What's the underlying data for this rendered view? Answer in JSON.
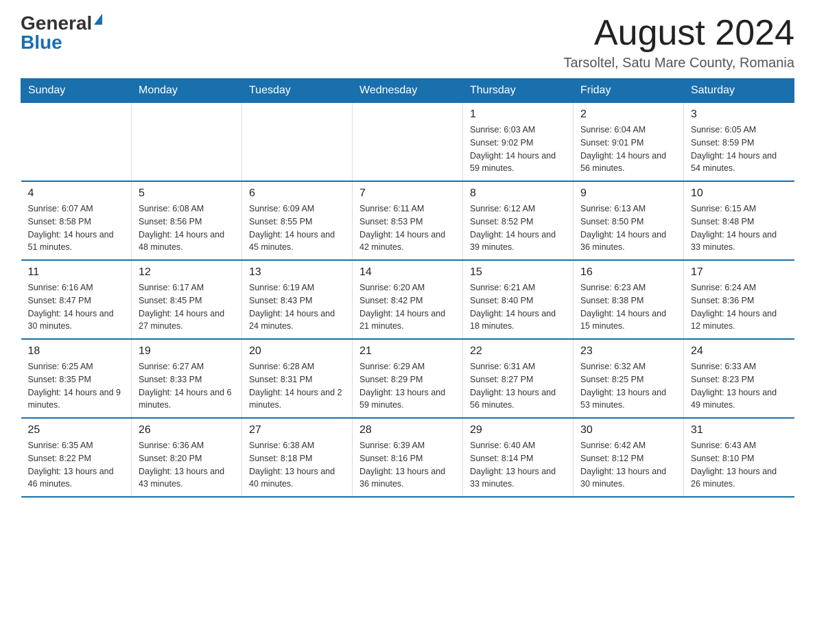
{
  "logo": {
    "general": "General",
    "blue": "Blue",
    "triangle": "▶"
  },
  "header": {
    "month_year": "August 2024",
    "location": "Tarsoltel, Satu Mare County, Romania"
  },
  "weekdays": [
    "Sunday",
    "Monday",
    "Tuesday",
    "Wednesday",
    "Thursday",
    "Friday",
    "Saturday"
  ],
  "weeks": [
    [
      {
        "day": "",
        "info": ""
      },
      {
        "day": "",
        "info": ""
      },
      {
        "day": "",
        "info": ""
      },
      {
        "day": "",
        "info": ""
      },
      {
        "day": "1",
        "info": "Sunrise: 6:03 AM\nSunset: 9:02 PM\nDaylight: 14 hours and 59 minutes."
      },
      {
        "day": "2",
        "info": "Sunrise: 6:04 AM\nSunset: 9:01 PM\nDaylight: 14 hours and 56 minutes."
      },
      {
        "day": "3",
        "info": "Sunrise: 6:05 AM\nSunset: 8:59 PM\nDaylight: 14 hours and 54 minutes."
      }
    ],
    [
      {
        "day": "4",
        "info": "Sunrise: 6:07 AM\nSunset: 8:58 PM\nDaylight: 14 hours and 51 minutes."
      },
      {
        "day": "5",
        "info": "Sunrise: 6:08 AM\nSunset: 8:56 PM\nDaylight: 14 hours and 48 minutes."
      },
      {
        "day": "6",
        "info": "Sunrise: 6:09 AM\nSunset: 8:55 PM\nDaylight: 14 hours and 45 minutes."
      },
      {
        "day": "7",
        "info": "Sunrise: 6:11 AM\nSunset: 8:53 PM\nDaylight: 14 hours and 42 minutes."
      },
      {
        "day": "8",
        "info": "Sunrise: 6:12 AM\nSunset: 8:52 PM\nDaylight: 14 hours and 39 minutes."
      },
      {
        "day": "9",
        "info": "Sunrise: 6:13 AM\nSunset: 8:50 PM\nDaylight: 14 hours and 36 minutes."
      },
      {
        "day": "10",
        "info": "Sunrise: 6:15 AM\nSunset: 8:48 PM\nDaylight: 14 hours and 33 minutes."
      }
    ],
    [
      {
        "day": "11",
        "info": "Sunrise: 6:16 AM\nSunset: 8:47 PM\nDaylight: 14 hours and 30 minutes."
      },
      {
        "day": "12",
        "info": "Sunrise: 6:17 AM\nSunset: 8:45 PM\nDaylight: 14 hours and 27 minutes."
      },
      {
        "day": "13",
        "info": "Sunrise: 6:19 AM\nSunset: 8:43 PM\nDaylight: 14 hours and 24 minutes."
      },
      {
        "day": "14",
        "info": "Sunrise: 6:20 AM\nSunset: 8:42 PM\nDaylight: 14 hours and 21 minutes."
      },
      {
        "day": "15",
        "info": "Sunrise: 6:21 AM\nSunset: 8:40 PM\nDaylight: 14 hours and 18 minutes."
      },
      {
        "day": "16",
        "info": "Sunrise: 6:23 AM\nSunset: 8:38 PM\nDaylight: 14 hours and 15 minutes."
      },
      {
        "day": "17",
        "info": "Sunrise: 6:24 AM\nSunset: 8:36 PM\nDaylight: 14 hours and 12 minutes."
      }
    ],
    [
      {
        "day": "18",
        "info": "Sunrise: 6:25 AM\nSunset: 8:35 PM\nDaylight: 14 hours and 9 minutes."
      },
      {
        "day": "19",
        "info": "Sunrise: 6:27 AM\nSunset: 8:33 PM\nDaylight: 14 hours and 6 minutes."
      },
      {
        "day": "20",
        "info": "Sunrise: 6:28 AM\nSunset: 8:31 PM\nDaylight: 14 hours and 2 minutes."
      },
      {
        "day": "21",
        "info": "Sunrise: 6:29 AM\nSunset: 8:29 PM\nDaylight: 13 hours and 59 minutes."
      },
      {
        "day": "22",
        "info": "Sunrise: 6:31 AM\nSunset: 8:27 PM\nDaylight: 13 hours and 56 minutes."
      },
      {
        "day": "23",
        "info": "Sunrise: 6:32 AM\nSunset: 8:25 PM\nDaylight: 13 hours and 53 minutes."
      },
      {
        "day": "24",
        "info": "Sunrise: 6:33 AM\nSunset: 8:23 PM\nDaylight: 13 hours and 49 minutes."
      }
    ],
    [
      {
        "day": "25",
        "info": "Sunrise: 6:35 AM\nSunset: 8:22 PM\nDaylight: 13 hours and 46 minutes."
      },
      {
        "day": "26",
        "info": "Sunrise: 6:36 AM\nSunset: 8:20 PM\nDaylight: 13 hours and 43 minutes."
      },
      {
        "day": "27",
        "info": "Sunrise: 6:38 AM\nSunset: 8:18 PM\nDaylight: 13 hours and 40 minutes."
      },
      {
        "day": "28",
        "info": "Sunrise: 6:39 AM\nSunset: 8:16 PM\nDaylight: 13 hours and 36 minutes."
      },
      {
        "day": "29",
        "info": "Sunrise: 6:40 AM\nSunset: 8:14 PM\nDaylight: 13 hours and 33 minutes."
      },
      {
        "day": "30",
        "info": "Sunrise: 6:42 AM\nSunset: 8:12 PM\nDaylight: 13 hours and 30 minutes."
      },
      {
        "day": "31",
        "info": "Sunrise: 6:43 AM\nSunset: 8:10 PM\nDaylight: 13 hours and 26 minutes."
      }
    ]
  ]
}
